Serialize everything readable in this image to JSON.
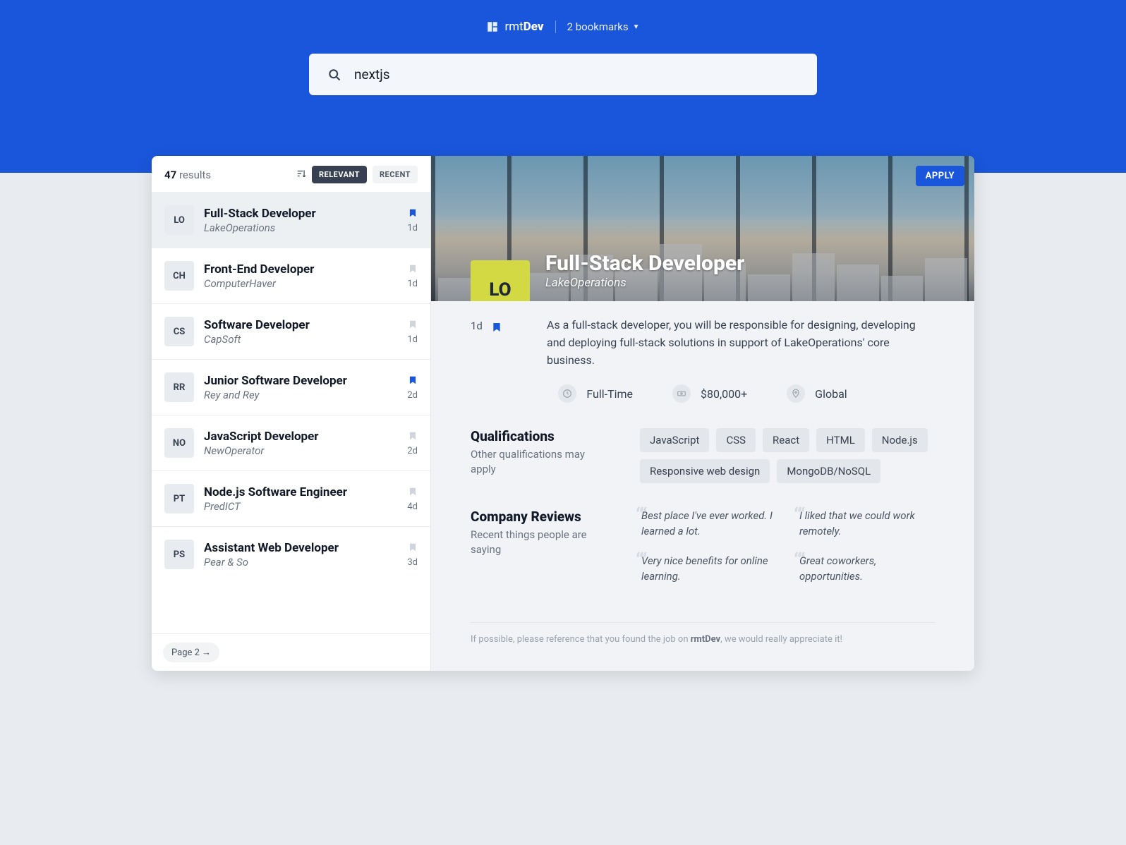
{
  "logo": {
    "prefix": "rmt",
    "bold": "Dev"
  },
  "bookmarks_label": "2 bookmarks",
  "search": {
    "value": "nextjs"
  },
  "results": {
    "count": "47",
    "label": "results"
  },
  "sort": {
    "relevant": "RELEVANT",
    "recent": "RECENT"
  },
  "jobs": [
    {
      "badge": "LO",
      "title": "Full-Stack Developer",
      "company": "LakeOperations",
      "age": "1d",
      "bookmarked": true,
      "selected": true
    },
    {
      "badge": "CH",
      "title": "Front-End Developer",
      "company": "ComputerHaver",
      "age": "1d",
      "bookmarked": false
    },
    {
      "badge": "CS",
      "title": "Software Developer",
      "company": "CapSoft",
      "age": "1d",
      "bookmarked": false
    },
    {
      "badge": "RR",
      "title": "Junior Software Developer",
      "company": "Rey and Rey",
      "age": "2d",
      "bookmarked": true
    },
    {
      "badge": "NO",
      "title": "JavaScript Developer",
      "company": "NewOperator",
      "age": "2d",
      "bookmarked": false
    },
    {
      "badge": "PT",
      "title": "Node.js Software Engineer",
      "company": "PredICT",
      "age": "4d",
      "bookmarked": false
    },
    {
      "badge": "PS",
      "title": "Assistant Web Developer",
      "company": "Pear & So",
      "age": "3d",
      "bookmarked": false
    }
  ],
  "pagination": {
    "next_label": "Page 2 →"
  },
  "detail": {
    "apply": "APPLY",
    "badge": "LO",
    "title": "Full-Stack Developer",
    "company": "LakeOperations",
    "age": "1d",
    "bookmarked": true,
    "description": "As a full-stack developer, you will be responsible for designing, developing and deploying full-stack solutions in support of LakeOperations' core business.",
    "chips": {
      "type": "Full-Time",
      "salary": "$80,000+",
      "location": "Global"
    },
    "qualifications": {
      "title": "Qualifications",
      "sub": "Other qualifications may apply",
      "tags": [
        "JavaScript",
        "CSS",
        "React",
        "HTML",
        "Node.js",
        "Responsive web design",
        "MongoDB/NoSQL"
      ]
    },
    "reviews": {
      "title": "Company Reviews",
      "sub": "Recent things people are saying",
      "items": [
        "Best place I've ever worked. I learned a lot.",
        "I liked that we could work remotely.",
        "Very nice benefits for online learning.",
        "Great coworkers, opportunities."
      ]
    },
    "footnote_pre": "If possible, please reference that you found the job on ",
    "footnote_brand": "rmtDev",
    "footnote_post": ", we would really appreciate it!"
  }
}
